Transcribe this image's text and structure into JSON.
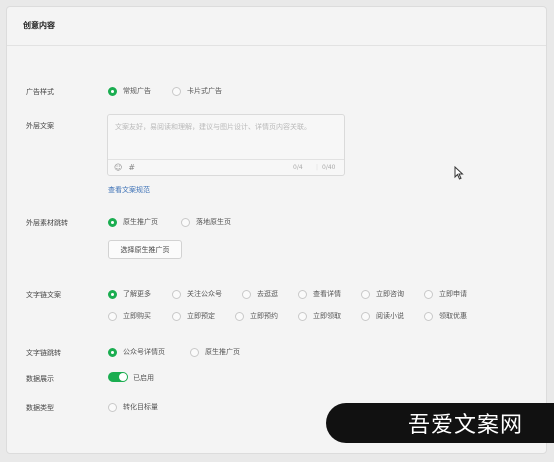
{
  "section": {
    "title": "创意内容"
  },
  "ad_style": {
    "label": "广告样式",
    "options": [
      "常规广告",
      "卡片式广告"
    ],
    "selected": "常规广告"
  },
  "outer_copy": {
    "label": "外层文案",
    "placeholder": "文案友好，易阅读和理解，建议与图片设计、详情页内容关联。",
    "emoji_icon": "smile-icon",
    "hash_icon": "hash-icon",
    "count_a": "0/4",
    "count_b": "0/40",
    "spec_link": "查看文案规范"
  },
  "outer_jump": {
    "label": "外层素材跳转",
    "options": [
      "原生推广页",
      "落地原生页"
    ],
    "selected": "原生推广页",
    "choose_button": "选择原生推广页"
  },
  "text_link_copy": {
    "label": "文字链文案",
    "options_row1": [
      "了解更多",
      "关注公众号",
      "去逛逛",
      "查看详情",
      "立即咨询",
      "立即申请"
    ],
    "options_row2": [
      "立即购买",
      "立即预定",
      "立即预约",
      "立即领取",
      "阅读小说",
      "领取优惠"
    ],
    "selected": "了解更多"
  },
  "text_link_jump": {
    "label": "文字链跳转",
    "options": [
      "公众号详情页",
      "原生推广页"
    ],
    "selected": "公众号详情页"
  },
  "data_display": {
    "label": "数据展示",
    "toggle_on": true,
    "toggle_text": "已启用"
  },
  "data_type": {
    "label": "数据类型",
    "options": [
      "转化目标量"
    ]
  },
  "watermark": {
    "text": "吾爱文案网"
  },
  "colors": {
    "accent": "#1aad50",
    "link": "#3a6fb5"
  }
}
